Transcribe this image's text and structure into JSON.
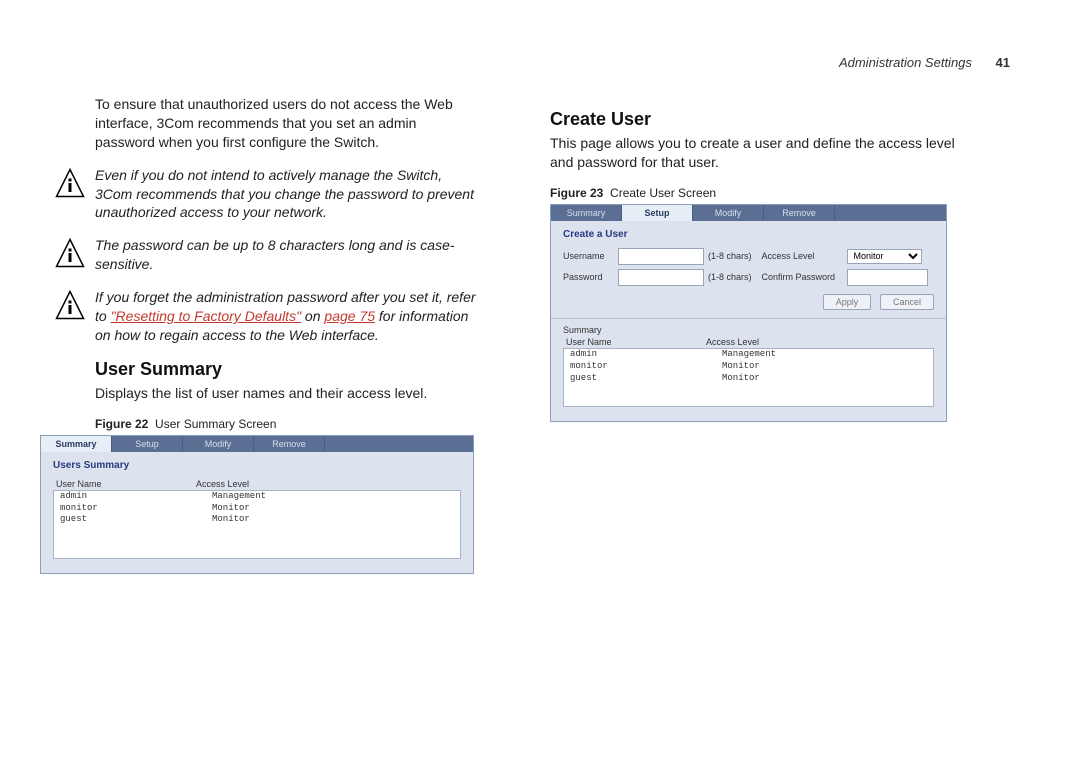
{
  "header": {
    "section": "Administration Settings",
    "page_number": "41"
  },
  "left": {
    "intro": "To ensure that unauthorized users do not access the Web interface, 3Com recommends that you set an admin password when you first configure the Switch.",
    "note1": "Even if you do not intend to actively manage the Switch, 3Com recommends that you change the password to prevent unauthorized access to your network.",
    "note2": "The password can be up to 8 characters long and is case-sensitive.",
    "note3_pre": "If you forget the administration password after you set it, refer to ",
    "note3_link1": "\"Resetting to Factory Defaults\"",
    "note3_mid": " on ",
    "note3_link2": "page 75",
    "note3_post": " for information on how to regain access to the Web interface.",
    "h2": "User Summary",
    "h2_body": "Displays the list of user names and their access level.",
    "fig_label": "Figure 22",
    "fig_title": "User Summary Screen",
    "fig22": {
      "tabs": [
        "Summary",
        "Setup",
        "Modify",
        "Remove"
      ],
      "panel_title": "Users Summary",
      "col1": "User Name",
      "col2": "Access Level",
      "rows": [
        {
          "u": "admin",
          "a": "Management"
        },
        {
          "u": "monitor",
          "a": "Monitor"
        },
        {
          "u": "guest",
          "a": "Monitor"
        }
      ]
    }
  },
  "right": {
    "h2": "Create User",
    "h2_body": "This page allows you to create a user and define the access level and password for that user.",
    "fig_label": "Figure 23",
    "fig_title": "Create User Screen",
    "fig23": {
      "tabs": [
        "Summary",
        "Setup",
        "Modify",
        "Remove"
      ],
      "panel_title": "Create a User",
      "lbl_username": "Username",
      "hint_username": "(1-8 chars)",
      "lbl_access": "Access Level",
      "sel_access": "Monitor",
      "lbl_password": "Password",
      "hint_password": "(1-8 chars)",
      "lbl_confirm": "Confirm Password",
      "btn_apply": "Apply",
      "btn_cancel": "Cancel",
      "summary_label": "Summary",
      "col1": "User Name",
      "col2": "Access Level",
      "rows": [
        {
          "u": "admin",
          "a": "Management"
        },
        {
          "u": "monitor",
          "a": "Monitor"
        },
        {
          "u": "guest",
          "a": "Monitor"
        }
      ]
    }
  }
}
